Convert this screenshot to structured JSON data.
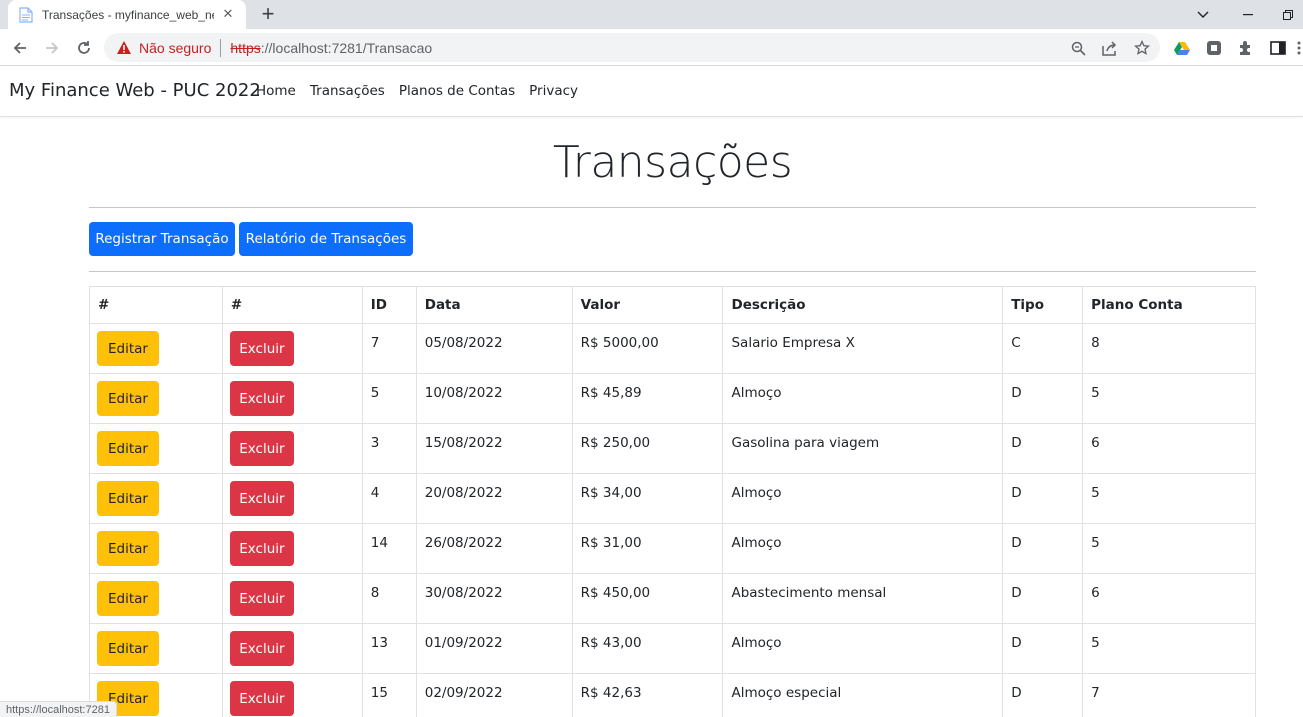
{
  "browser": {
    "tab_title": "Transações - myfinance_web_net",
    "security_label": "Não seguro",
    "url_scheme": "https",
    "url_rest": "://localhost:7281/Transacao",
    "status_url": "https://localhost:7281"
  },
  "site": {
    "brand": "My Finance Web - PUC 2022",
    "nav": [
      "Home",
      "Transações",
      "Planos de Contas",
      "Privacy"
    ]
  },
  "page": {
    "title": "Transações",
    "register_button": "Registrar Transação",
    "report_button": "Relatório de Transações"
  },
  "table": {
    "headers": [
      "#",
      "#",
      "ID",
      "Data",
      "Valor",
      "Descrição",
      "Tipo",
      "Plano Conta"
    ],
    "edit_label": "Editar",
    "delete_label": "Excluir",
    "rows": [
      {
        "id": "7",
        "data": "05/08/2022",
        "valor": "R$ 5000,00",
        "descricao": "Salario Empresa X",
        "tipo": "C",
        "plano": "8"
      },
      {
        "id": "5",
        "data": "10/08/2022",
        "valor": "R$ 45,89",
        "descricao": "Almoço",
        "tipo": "D",
        "plano": "5"
      },
      {
        "id": "3",
        "data": "15/08/2022",
        "valor": "R$ 250,00",
        "descricao": "Gasolina para viagem",
        "tipo": "D",
        "plano": "6"
      },
      {
        "id": "4",
        "data": "20/08/2022",
        "valor": "R$ 34,00",
        "descricao": "Almoço",
        "tipo": "D",
        "plano": "5"
      },
      {
        "id": "14",
        "data": "26/08/2022",
        "valor": "R$ 31,00",
        "descricao": "Almoço",
        "tipo": "D",
        "plano": "5"
      },
      {
        "id": "8",
        "data": "30/08/2022",
        "valor": "R$ 450,00",
        "descricao": "Abastecimento mensal",
        "tipo": "D",
        "plano": "6"
      },
      {
        "id": "13",
        "data": "01/09/2022",
        "valor": "R$ 43,00",
        "descricao": "Almoço",
        "tipo": "D",
        "plano": "5"
      },
      {
        "id": "15",
        "data": "02/09/2022",
        "valor": "R$ 42,63",
        "descricao": "Almoço especial",
        "tipo": "D",
        "plano": "7"
      }
    ]
  },
  "colors": {
    "primary": "#0d6efd",
    "warning": "#ffc107",
    "danger": "#dc3545"
  }
}
